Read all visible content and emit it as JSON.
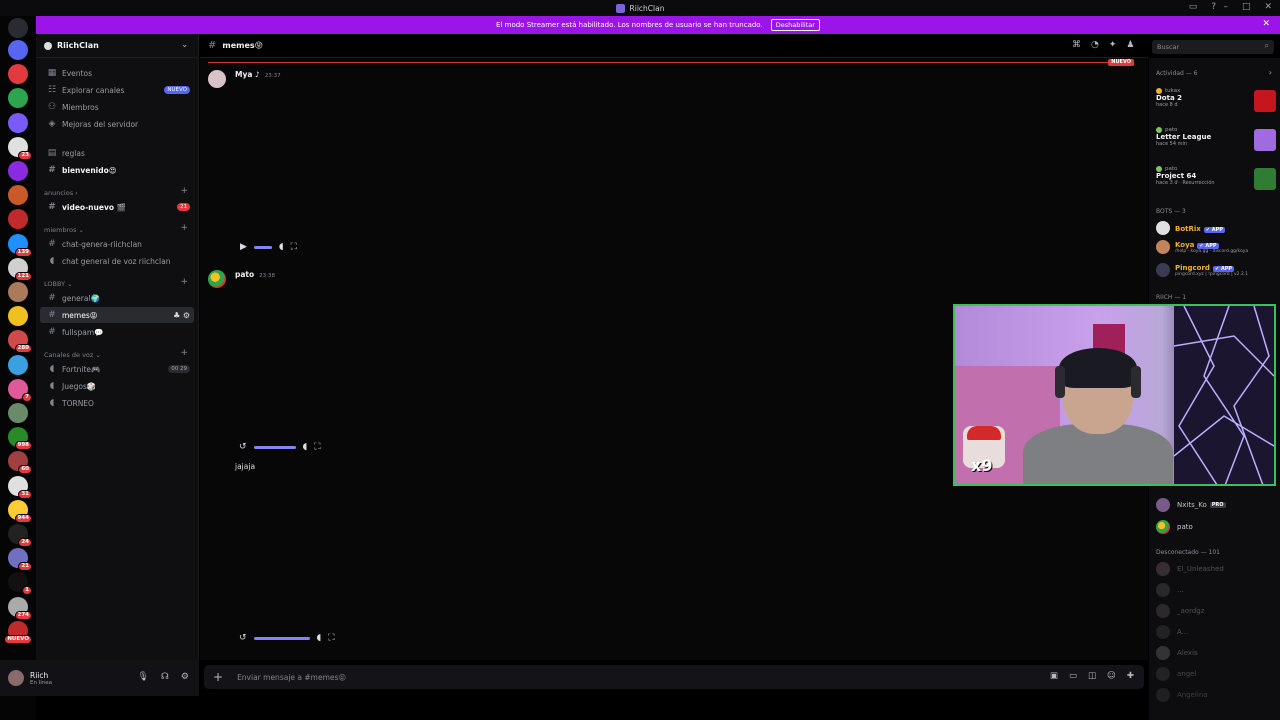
{
  "window": {
    "title": "RiichClan"
  },
  "banner": {
    "text": "El modo Streamer está habilitado. Los nombres de usuario se han truncado.",
    "button": "Deshabilitar"
  },
  "guild_badges": [
    "",
    "",
    "",
    "",
    "23",
    "",
    "",
    "",
    "139",
    "121",
    "",
    "",
    "280",
    "",
    "7",
    "",
    "998",
    "60",
    "31",
    "944",
    "24",
    "21",
    "1",
    "274",
    "NUEVO"
  ],
  "server": {
    "name": "RiichClan"
  },
  "nav": {
    "events": "Eventos",
    "explore": "Explorar canales",
    "explore_tag": "NUEVO",
    "members": "Miembros",
    "boosts": "Mejoras del servidor"
  },
  "channels": {
    "reglas": "reglas",
    "bienvenido": "bienvenido😍",
    "cat_anuncios": "anuncios ›",
    "video_nuevo": "video-nuevo 🎬",
    "video_nuevo_badge": "21",
    "cat_miembros": "miembros ⌄",
    "chat_genera": "chat-genera-riichclan",
    "chat_voz": "chat general de voz riichclan",
    "cat_lobby": "LOBBY ⌄",
    "general": "general🌍",
    "memes": "memes😝",
    "fullspam": "fullspam💬",
    "cat_voz": "Canales de voz ⌄",
    "fortnite": "Fortnite🎮",
    "fortnite_count": "00 29",
    "juegos": "Juegos🎲",
    "torneo": "TORNEO"
  },
  "user": {
    "name": "Riich",
    "status": "En línea"
  },
  "header": {
    "channel": "memes😝",
    "search_placeholder": "Buscar"
  },
  "chat": {
    "new_tag": "NUEVO",
    "messages": [
      {
        "author": "Mya ♪",
        "time": "23:37"
      },
      {
        "author": "pato",
        "time": "23:38",
        "text": "jajaja"
      }
    ]
  },
  "composer": {
    "placeholder": "Enviar mensaje a #memes😝"
  },
  "members_panel": {
    "activity_header": "Actividad — 6",
    "activities": [
      {
        "user": "tukax",
        "game": "Dota 2",
        "meta": "hace 8 d"
      },
      {
        "user": "pato",
        "game": "Letter League",
        "meta": "hace 54 min"
      },
      {
        "user": "pato",
        "game": "Project 64",
        "meta": "hace 3 d  · Resurrección"
      }
    ],
    "bots_header": "BOTS — 3",
    "bots": [
      {
        "name": "BotRix",
        "tag": "✔ APP",
        "sub": ""
      },
      {
        "name": "Koya",
        "tag": "✔ APP",
        "sub": "/help · koya.gg · discord.gg/koya"
      },
      {
        "name": "Pingcord",
        "tag": "✔ APP",
        "sub": "pingcord.xyz | !pingcord | v2.2.1"
      }
    ],
    "riich_header": "RIICH — 1",
    "members_online": [
      {
        "name": "Nxits_Ko",
        "tag": "PRO"
      },
      {
        "name": "pato"
      }
    ],
    "offline_header": "Desconectado — 101",
    "offline": [
      "El_Unleashed",
      "...",
      "_aordgz",
      "A...",
      "Alexis",
      "angel",
      "Angelina"
    ]
  },
  "webcam": {
    "overlay": "x9"
  },
  "colors": {
    "banner": "#9b14e8",
    "online": "#7fc65a",
    "bot_name": "#f0b232",
    "app_tag": "#5865f2",
    "new": "#e23a3f",
    "webcam_border": "#3bc15a"
  }
}
